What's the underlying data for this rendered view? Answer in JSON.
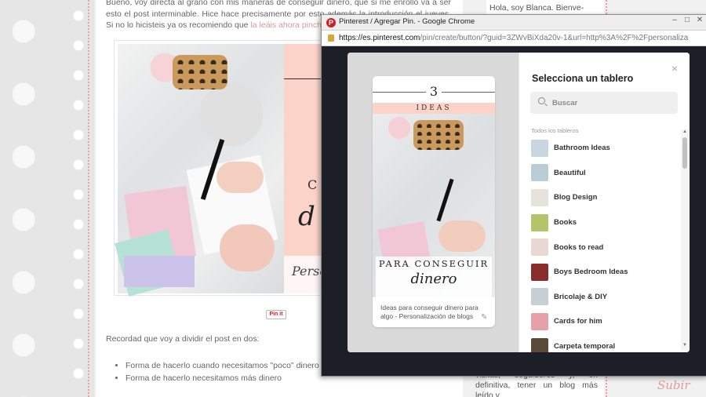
{
  "blog": {
    "intro_text": "Bueno, voy directa al grano con mis maneras de conseguir dinero, que si me enrollo va a ser esto el post interminable. Hice hace precisamente por esto además la introducción el jueves.",
    "intro_link_prefix": "Si no lo hicisteis ya os recomiendo que ",
    "intro_link": "la leáis ahora pinch",
    "image_text": {
      "letter_small": "C",
      "letter_big": "d",
      "person_script": "Perso"
    },
    "pinit_label": "Pin it",
    "recordad": "Recordad que voy a dividir el post en dos:",
    "bullets": [
      "Forma de hacerlo cuando necesitamos \"poco\" dinero",
      "Forma de hacerlo necesitamos más dinero"
    ],
    "sidebar_greeting": "Hola, soy Blanca. Bienve-",
    "sidebar_bottom": "visitas, seguidores y, en definitiva, tener un blog más leído y",
    "subir": "Subir"
  },
  "window": {
    "title": "Pinterest / Agregar Pin. - Google Chrome",
    "url_host": "https://es.pinterest.com",
    "url_rest": "/pin/create/button/?guid=3ZWvBiXda20v-1&url=http%3A%2F%2Fpersonaliza",
    "logo_letter": "P",
    "minimize": "–",
    "maximize": "□",
    "close": "✕"
  },
  "pin": {
    "number": "3",
    "ideas": "IDEAS",
    "line1": "PARA CONSEGUIR",
    "line2": "dinero",
    "description": "Ideas para conseguir dinero para algo - Personalización de blogs"
  },
  "boards_panel": {
    "heading": "Selecciona un tablero",
    "search_placeholder": "Buscar",
    "section_label": "Todos los tableros",
    "close_glyph": "×",
    "boards": [
      {
        "name": "Bathroom Ideas",
        "thumb_color": "#c9d6df"
      },
      {
        "name": "Beautiful",
        "thumb_color": "#b9cdd6"
      },
      {
        "name": "Blog Design",
        "thumb_color": "#e6e2dc"
      },
      {
        "name": "Books",
        "thumb_color": "#b5c46a"
      },
      {
        "name": "Books to read",
        "thumb_color": "#e9d7d6"
      },
      {
        "name": "Boys Bedroom Ideas",
        "thumb_color": "#8b2c2c"
      },
      {
        "name": "Bricolaje & DIY",
        "thumb_color": "#c7cfd4"
      },
      {
        "name": "Cards for him",
        "thumb_color": "#e8a0a8"
      },
      {
        "name": "Carpeta temporal",
        "thumb_color": "#5a4a3a"
      }
    ]
  }
}
